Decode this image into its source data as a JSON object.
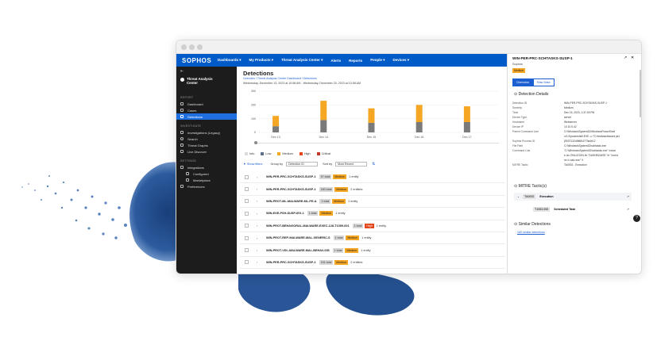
{
  "topbar": {
    "logo": "SOPHOS",
    "nav": [
      "Dashboards ▾",
      "My Products ▾",
      "Threat Analysis Center ▾",
      "Alerts",
      "Reports",
      "People ▾",
      "Devices ▾"
    ]
  },
  "sidebar": {
    "app_title": "Threat Analysis Center",
    "groups": [
      {
        "heading": "REPORT",
        "items": [
          {
            "label": "Dashboard",
            "icon": "dashboard-icon"
          },
          {
            "label": "Cases",
            "icon": "cases-icon"
          },
          {
            "label": "Detections",
            "icon": "detections-icon",
            "active": true
          }
        ]
      },
      {
        "heading": "INVESTIGATE",
        "items": [
          {
            "label": "Investigations (Legacy)",
            "icon": "investigations-icon"
          },
          {
            "label": "Search",
            "icon": "search-icon"
          },
          {
            "label": "Threat Graphs",
            "icon": "threat-graphs-icon"
          },
          {
            "label": "Live Discover",
            "icon": "live-discover-icon"
          }
        ]
      },
      {
        "heading": "SETTINGS",
        "items": [
          {
            "label": "Integrations",
            "icon": "integrations-icon"
          },
          {
            "label": "Configured",
            "icon": "configured-icon",
            "sub": true
          },
          {
            "label": "Marketplace",
            "icon": "marketplace-icon",
            "sub": true
          },
          {
            "label": "Preferences",
            "icon": "preferences-icon"
          }
        ]
      }
    ]
  },
  "main": {
    "title": "Detections",
    "breadcrumb": "Overview  /  Threat Analysis Center Dashboard  /  Detections",
    "timerange": "Wednesday, December 13, 2023 at 10:58 AM  -  Wednesday, December 20, 2023 at 10:58 AM",
    "legend": [
      {
        "label": "Info",
        "color": "#d9d9d9"
      },
      {
        "label": "Low",
        "color": "#5c6f8a"
      },
      {
        "label": "Medium",
        "color": "#f5a623"
      },
      {
        "label": "High",
        "color": "#e2461a"
      },
      {
        "label": "Critical",
        "color": "#c0392b"
      }
    ],
    "filters": {
      "show_filters": "▼ Show filters",
      "group_by_label": "Group by",
      "group_by_value": "Detection ID",
      "sort_label": "Sort by",
      "sort_value": "Most Recent"
    },
    "rows": [
      {
        "name": "WIN-PER-PRC-SCHTASKS-SUSP-1",
        "total": "97 total",
        "severity": "Medium",
        "entity": "1 entity"
      },
      {
        "name": "WIN-PER-PRC-SCHTASKS-SUSP-1",
        "total": "160 total",
        "severity": "Medium",
        "entity": "2 entities"
      },
      {
        "name": "WIN-PROT-ML-MALWARE-ML-PE-A",
        "total": "1 total",
        "severity": "Medium",
        "entity": "1 entity"
      },
      {
        "name": "WIN-EXE-PSH-SUSP-IEX-1",
        "total": "1 total",
        "severity": "Medium",
        "entity": "1 entity"
      },
      {
        "name": "WIN-PROT-BEHAVIORAL-MALWARE-EXEC-128-T1059-001",
        "total": "1 total",
        "severity": "High",
        "entity": "1 entity"
      },
      {
        "name": "WIN-PROT-REP-MALWARE-MAL-GENERIC-S",
        "total": "1 total",
        "severity": "Medium",
        "entity": "1 entity"
      },
      {
        "name": "WIN-PROT-VDL-MALWARE-MAL-BEHAV-035",
        "total": "1 total",
        "severity": "Medium",
        "entity": "1 entity"
      },
      {
        "name": "WIN-PER-PRC-SCHTASKS-SUSP-1",
        "total": "151 total",
        "severity": "Medium",
        "entity": "2 entities"
      }
    ]
  },
  "chart_data": {
    "type": "bar",
    "categories": [
      "Dec 13",
      "Dec 14",
      "Dec 15",
      "Dec 16",
      "Dec 17"
    ],
    "series": [
      {
        "name": "Low",
        "values": [
          45,
          90,
          70,
          75,
          75
        ],
        "color": "#7a7a7a"
      },
      {
        "name": "Medium",
        "values": [
          75,
          140,
          105,
          125,
          115
        ],
        "color": "#f5a623"
      }
    ],
    "ylim": [
      0,
      300
    ],
    "yticks": [
      0,
      100,
      200,
      300
    ],
    "grid": true
  },
  "panel": {
    "title": "WIN-PER-PRC-SCHTASKS-SUSP-1",
    "subtitle": "Sophos",
    "badge": "Medium",
    "tabs": [
      "Overview",
      "Raw Data"
    ],
    "details_heading": "⊙  Detection Details",
    "details": [
      {
        "k": "Detection ID",
        "v": "WIN-PER-PRC-SCHTASKS-SUSP-1"
      },
      {
        "k": "Severity",
        "v": "Medium"
      },
      {
        "k": "Time",
        "v": "Dec 16, 2023, 1:37:49 PM"
      },
      {
        "k": "Device Type",
        "v": "server"
      },
      {
        "k": "Hostname",
        "v": "Webserver"
      },
      {
        "k": "Device IP",
        "v": "10.10.5.42"
      },
      {
        "k": "Parent Command Line",
        "v": "C:\\Windows\\System32\\WindowsPowerShell"
      },
      {
        "k": "",
        "v": "\\v1.0\\powershell.EXE -c \\\"C:\\test\\dashboard.ps1"
      },
      {
        "k": "Sophos Process ID",
        "v": "{903713245f6f04779a4b12"
      },
      {
        "k": "File Path",
        "v": "C:\\Windows\\System32\\schtasks.exe"
      },
      {
        "k": "Command Line",
        "v": "\"C:\\Windows\\System32\\schtasks.exe\" /creat"
      },
      {
        "k": "",
        "v": "e /sc ONLOGON /tn \"DASHBOARD\" /tr \"cmd.e"
      },
      {
        "k": "",
        "v": "xe /c calc.exe\" /f"
      },
      {
        "k": "MITRE Tactic",
        "v": "TA0002 - Execution"
      }
    ],
    "mitre_heading": "⊙  MITRE Tactic(s)",
    "mitre": [
      {
        "code": "TA0002",
        "label": "Execution"
      },
      {
        "code": "T1053.005",
        "label": "Scheduled Task"
      }
    ],
    "similar_heading": "⊙  Similar Detections",
    "similar_link": "160 similar detections"
  }
}
